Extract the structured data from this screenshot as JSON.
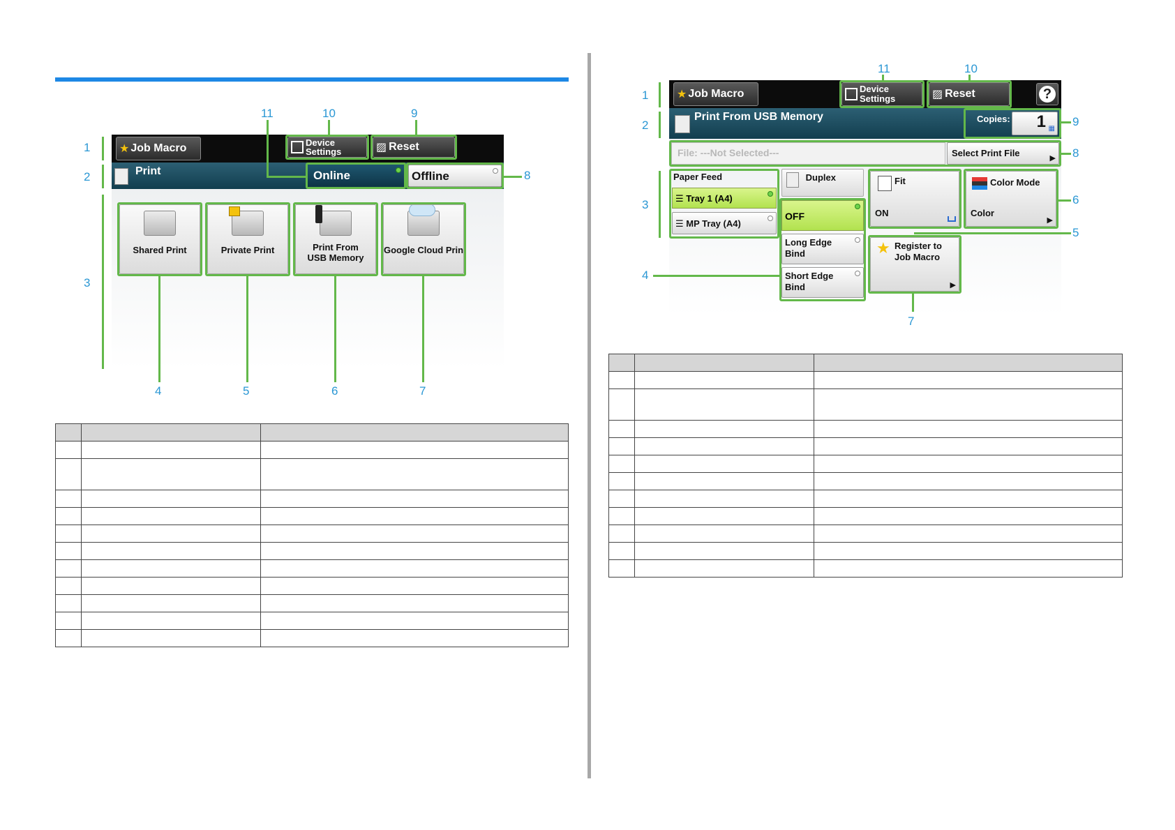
{
  "left_panel": {
    "job_macro": "Job Macro",
    "device_settings": "Device Settings",
    "reset": "Reset",
    "title": "Print",
    "online": "Online",
    "offline": "Offline",
    "tiles": [
      "Shared Print",
      "Private Print",
      "Print From USB Memory",
      "Google Cloud Print"
    ]
  },
  "left_callouts": {
    "top": [
      "11",
      "10",
      "9"
    ],
    "left": [
      "1",
      "2",
      "3"
    ],
    "right": [
      "8"
    ],
    "bottom": [
      "4",
      "5",
      "6",
      "7"
    ]
  },
  "right_panel": {
    "job_macro": "Job Macro",
    "device_settings": "Device Settings",
    "reset": "Reset",
    "help": "?",
    "title": "Print From USB Memory",
    "copies_label": "Copies:",
    "copies_value": "1",
    "file_placeholder": "File: ---Not Selected---",
    "select_print_file": "Select Print File",
    "paper_feed": "Paper Feed",
    "tray1": "Tray 1 (A4)",
    "mp_tray": "MP Tray (A4)",
    "duplex": "Duplex",
    "duplex_off": "OFF",
    "long_edge": "Long Edge Bind",
    "short_edge": "Short Edge Bind",
    "fit": "Fit",
    "fit_value": "ON",
    "color_mode": "Color Mode",
    "color_value": "Color",
    "register": "Register to Job Macro"
  },
  "right_callouts": {
    "top": [
      "11",
      "10"
    ],
    "left": [
      "1",
      "2",
      "3",
      "4"
    ],
    "right": [
      "9",
      "8",
      "6",
      "5"
    ],
    "bottom": [
      "7"
    ]
  },
  "tables": {
    "left_rows": 12,
    "left_tall_row": 2,
    "right_rows": 12,
    "right_tall_row": 2
  }
}
